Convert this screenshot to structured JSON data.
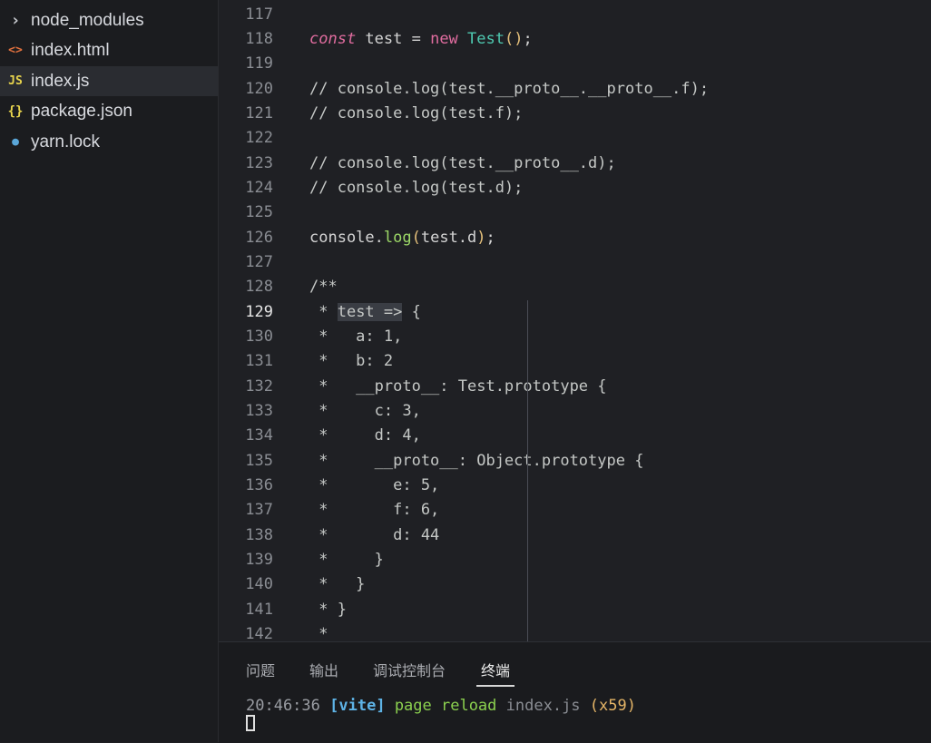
{
  "sidebar": {
    "items": [
      {
        "icon": "chevron-right-icon",
        "glyph": "›",
        "label": "node_modules"
      },
      {
        "icon": "html-file-icon",
        "glyph": "<>",
        "label": "index.html"
      },
      {
        "icon": "js-file-icon",
        "glyph": "JS",
        "label": "index.js"
      },
      {
        "icon": "json-file-icon",
        "glyph": "{}",
        "label": "package.json"
      },
      {
        "icon": "yarn-file-icon",
        "glyph": "●",
        "label": "yarn.lock"
      }
    ]
  },
  "editor": {
    "current_line": "129",
    "lines": [
      {
        "n": "117",
        "text": ""
      },
      {
        "n": "118",
        "kw": "const",
        "rest1": " test = ",
        "kw2": "new",
        "sp": " ",
        "cls": "Test",
        "paren": "()",
        "end": ";"
      },
      {
        "n": "119",
        "text": ""
      },
      {
        "n": "120",
        "comment": "// console.log(test.__proto__.__proto__.f);"
      },
      {
        "n": "121",
        "comment": "// console.log(test.f);"
      },
      {
        "n": "122",
        "text": ""
      },
      {
        "n": "123",
        "comment": "// console.log(test.__proto__.d);"
      },
      {
        "n": "124",
        "comment": "// console.log(test.d);"
      },
      {
        "n": "125",
        "text": ""
      },
      {
        "n": "126",
        "pre": "console.",
        "fn": "log",
        "paren_open": "(",
        "mid": "test.d",
        "paren_close": ")",
        "end": ";"
      },
      {
        "n": "127",
        "text": ""
      },
      {
        "n": "128",
        "comment": "/**"
      },
      {
        "n": "129",
        "lead": " * ",
        "selected": "test =>",
        "after": " {"
      },
      {
        "n": "130",
        "comment": " *   a: 1,"
      },
      {
        "n": "131",
        "comment": " *   b: 2"
      },
      {
        "n": "132",
        "comment": " *   __proto__: Test.prototype {"
      },
      {
        "n": "133",
        "comment": " *     c: 3,"
      },
      {
        "n": "134",
        "comment": " *     d: 4,"
      },
      {
        "n": "135",
        "comment": " *     __proto__: Object.prototype {"
      },
      {
        "n": "136",
        "comment": " *       e: 5,"
      },
      {
        "n": "137",
        "comment": " *       f: 6,"
      },
      {
        "n": "138",
        "comment": " *       d: 44"
      },
      {
        "n": "139",
        "comment": " *     }"
      },
      {
        "n": "140",
        "comment": " *   }"
      },
      {
        "n": "141",
        "comment": " * }"
      },
      {
        "n": "142",
        "comment": " *"
      }
    ]
  },
  "panel": {
    "tabs": [
      "问题",
      "输出",
      "调试控制台",
      "终端"
    ],
    "active_tab": "终端",
    "terminal": {
      "time": "20:46:36",
      "tag": "[vite]",
      "message": "page reload",
      "file": "index.js",
      "count": "(x59)"
    }
  },
  "colors": {
    "keyword": "#e06c9f",
    "class": "#4ec9b0",
    "function": "#9cd867",
    "vite_tag": "#5eb3e6",
    "reload_msg": "#8bd04f",
    "count": "#e5b567"
  }
}
